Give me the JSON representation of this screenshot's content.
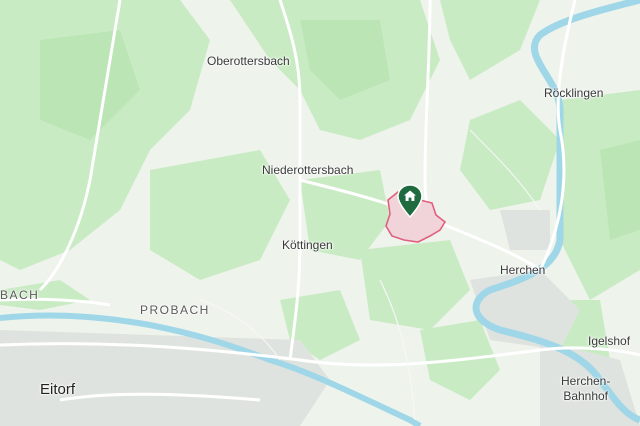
{
  "places": {
    "oberottersbach": "Oberottersbach",
    "niederottersbach": "Niederottersbach",
    "koettingen": "Köttingen",
    "herchen": "Herchen",
    "roecklingen": "Röcklingen",
    "igelshof": "Igelshof",
    "herchen_bahnhof_line1": "Herchen-",
    "herchen_bahnhof_line2": "Bahnhof",
    "eitorf": "Eitorf",
    "probach": "PROBACH",
    "bach": "BACH"
  },
  "marker": {
    "icon": "home-icon",
    "color": "#1f6b3f"
  },
  "colors": {
    "forest": "#c9ebc4",
    "meadow": "#eef3ec",
    "water": "#9fd7e8",
    "road": "#ffffff",
    "boundary": "#e0607e",
    "boundary_fill": "#f0d4da",
    "settlement": "#dfe3df"
  }
}
